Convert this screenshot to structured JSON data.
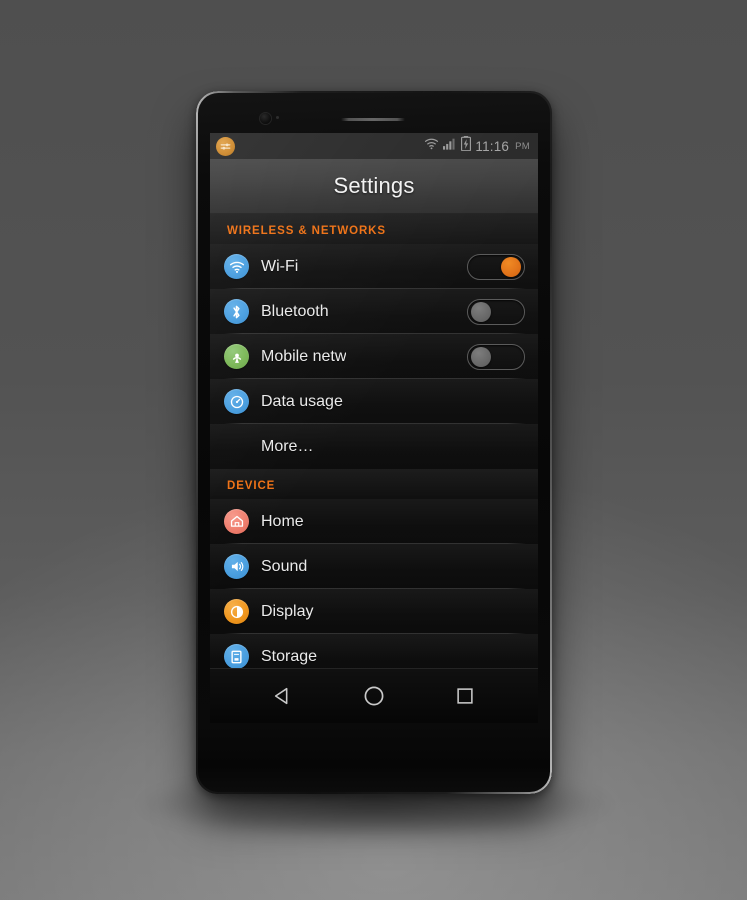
{
  "device": {
    "hardware": {
      "front_camera": "front-camera",
      "earpiece": "earpiece-speaker"
    }
  },
  "status_bar": {
    "notification_icon": "settings-sliders-icon",
    "icons": [
      "wifi-icon",
      "cellular-signal-icon",
      "battery-charging-icon"
    ],
    "time": "11:16",
    "ampm": "PM"
  },
  "action_bar": {
    "title": "Settings"
  },
  "sections": [
    {
      "header": "WIRELESS & NETWORKS",
      "rows": [
        {
          "label": "Wi-Fi",
          "icon": "wifi-icon",
          "icon_color": "#4a9fe0",
          "toggle": "on"
        },
        {
          "label": "Bluetooth",
          "icon": "bluetooth-icon",
          "icon_color": "#4a9fe0",
          "toggle": "off"
        },
        {
          "label": "Mobile netw",
          "icon": "mobile-network-icon",
          "icon_color": "#7cb858",
          "toggle": "off"
        },
        {
          "label": "Data usage",
          "icon": "data-usage-icon",
          "icon_color": "#4a9fe0",
          "toggle": "none"
        },
        {
          "label": "More…",
          "icon": "none",
          "icon_color": "",
          "toggle": "none"
        }
      ]
    },
    {
      "header": "DEVICE",
      "rows": [
        {
          "label": "Home",
          "icon": "home-icon",
          "icon_color": "#ef7e6e",
          "toggle": "none"
        },
        {
          "label": "Sound",
          "icon": "sound-icon",
          "icon_color": "#4a9fe0",
          "toggle": "none"
        },
        {
          "label": "Display",
          "icon": "brightness-icon",
          "icon_color": "#f0971f",
          "toggle": "none"
        },
        {
          "label": "Storage",
          "icon": "storage-icon",
          "icon_color": "#4a9fe0",
          "toggle": "none"
        }
      ]
    }
  ],
  "nav_bar": {
    "buttons": [
      {
        "name": "back-button",
        "icon": "back-triangle-icon"
      },
      {
        "name": "home-button",
        "icon": "home-circle-icon"
      },
      {
        "name": "recents-button",
        "icon": "recents-square-icon"
      }
    ]
  },
  "colors": {
    "accent_orange": "#ef7216",
    "icon_blue": "#4a9fe0",
    "icon_green": "#7cb858",
    "icon_salmon": "#ef7e6e",
    "icon_amber": "#f0971f",
    "toggle_on": "#e2741a",
    "toggle_off": "#6a6a6a",
    "backdrop": "#545454"
  }
}
